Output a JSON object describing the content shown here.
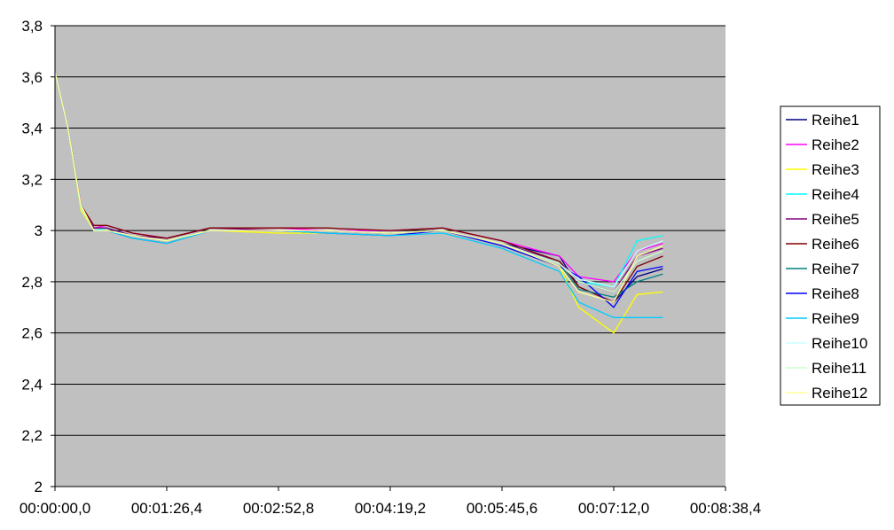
{
  "chart_data": {
    "type": "line",
    "title": "",
    "xlabel": "",
    "ylabel": "",
    "x_ticks": [
      "00:00:00,0",
      "00:01:26,4",
      "00:02:52,8",
      "00:04:19,2",
      "00:05:45,6",
      "00:07:12,0",
      "00:08:38,4"
    ],
    "xlim": [
      "00:00:00,0",
      "00:08:38,4"
    ],
    "y_ticks": [
      "2",
      "2,2",
      "2,4",
      "2,6",
      "2,8",
      "3",
      "3,2",
      "3,4",
      "3,6",
      "3,8"
    ],
    "ylim": [
      2,
      3.8
    ],
    "grid": "horizontal",
    "legend_position": "right",
    "plot_background": "#c0c0c0",
    "x_unit_note": "time hh:mm:ss,t",
    "x": [
      "00:00:00,0",
      "00:00:10,0",
      "00:00:20,0",
      "00:00:30,0",
      "00:00:40,0",
      "00:01:00,0",
      "00:01:26,4",
      "00:02:00,0",
      "00:02:52,8",
      "00:03:30,0",
      "00:04:19,2",
      "00:05:00,0",
      "00:05:45,6",
      "00:06:30,0",
      "00:06:45,0",
      "00:07:12,0",
      "00:07:30,0",
      "00:07:50,0"
    ],
    "series": [
      {
        "name": "Reihe1",
        "color": "#000080",
        "values": [
          3.62,
          3.4,
          3.1,
          3.0,
          3.0,
          2.98,
          2.96,
          3.0,
          3.0,
          3.0,
          2.99,
          3.0,
          2.95,
          2.9,
          2.78,
          2.72,
          2.82,
          2.85
        ]
      },
      {
        "name": "Reihe2",
        "color": "#ff00ff",
        "values": [
          3.62,
          3.4,
          3.1,
          3.01,
          3.02,
          2.99,
          2.97,
          3.01,
          3.01,
          3.0,
          3.0,
          3.01,
          2.96,
          2.9,
          2.82,
          2.8,
          2.92,
          2.95
        ]
      },
      {
        "name": "Reihe3",
        "color": "#ffff00",
        "values": [
          3.62,
          3.4,
          3.08,
          3.0,
          3.0,
          2.97,
          2.95,
          3.0,
          2.99,
          2.99,
          2.98,
          3.0,
          2.94,
          2.86,
          2.7,
          2.6,
          2.75,
          2.76
        ]
      },
      {
        "name": "Reihe4",
        "color": "#00ffff",
        "values": [
          3.62,
          3.4,
          3.09,
          3.0,
          3.01,
          2.98,
          2.96,
          3.0,
          3.0,
          3.0,
          2.99,
          3.0,
          2.95,
          2.88,
          2.8,
          2.78,
          2.96,
          2.98
        ]
      },
      {
        "name": "Reihe5",
        "color": "#800080",
        "values": [
          3.62,
          3.4,
          3.1,
          3.01,
          3.01,
          2.98,
          2.97,
          3.01,
          3.0,
          3.0,
          2.99,
          3.0,
          2.95,
          2.88,
          2.8,
          2.76,
          2.9,
          2.93
        ]
      },
      {
        "name": "Reihe6",
        "color": "#800000",
        "values": [
          3.62,
          3.4,
          3.1,
          3.02,
          3.02,
          2.99,
          2.97,
          3.01,
          3.01,
          3.01,
          3.0,
          3.01,
          2.96,
          2.88,
          2.78,
          2.72,
          2.86,
          2.9
        ]
      },
      {
        "name": "Reihe7",
        "color": "#008080",
        "values": [
          3.62,
          3.4,
          3.09,
          3.0,
          3.0,
          2.98,
          2.96,
          3.0,
          3.0,
          3.0,
          2.99,
          3.0,
          2.95,
          2.87,
          2.77,
          2.74,
          2.8,
          2.83
        ]
      },
      {
        "name": "Reihe8",
        "color": "#0000ff",
        "values": [
          3.62,
          3.4,
          3.09,
          3.0,
          3.0,
          2.97,
          2.95,
          3.0,
          3.0,
          2.99,
          2.98,
          3.0,
          2.94,
          2.86,
          2.82,
          2.7,
          2.84,
          2.86
        ]
      },
      {
        "name": "Reihe9",
        "color": "#00ccff",
        "values": [
          3.62,
          3.4,
          3.09,
          3.0,
          3.0,
          2.97,
          2.95,
          3.0,
          3.0,
          2.99,
          2.98,
          2.99,
          2.93,
          2.84,
          2.72,
          2.66,
          2.66,
          2.66
        ]
      },
      {
        "name": "Reihe10",
        "color": "#ccffff",
        "values": [
          3.62,
          3.4,
          3.09,
          3.0,
          3.0,
          2.98,
          2.96,
          3.0,
          3.0,
          3.0,
          2.99,
          3.0,
          2.95,
          2.87,
          2.81,
          2.78,
          2.92,
          2.96
        ]
      },
      {
        "name": "Reihe11",
        "color": "#ccffcc",
        "values": [
          3.62,
          3.4,
          3.09,
          3.0,
          3.0,
          2.98,
          2.96,
          3.0,
          3.0,
          3.0,
          2.99,
          3.0,
          2.95,
          2.87,
          2.8,
          2.76,
          2.88,
          2.92
        ]
      },
      {
        "name": "Reihe12",
        "color": "#ffff99",
        "values": [
          3.62,
          3.4,
          3.1,
          3.0,
          3.0,
          2.98,
          2.96,
          3.0,
          3.0,
          3.0,
          2.99,
          3.0,
          2.95,
          2.86,
          2.76,
          2.72,
          2.9,
          2.94
        ]
      }
    ]
  }
}
